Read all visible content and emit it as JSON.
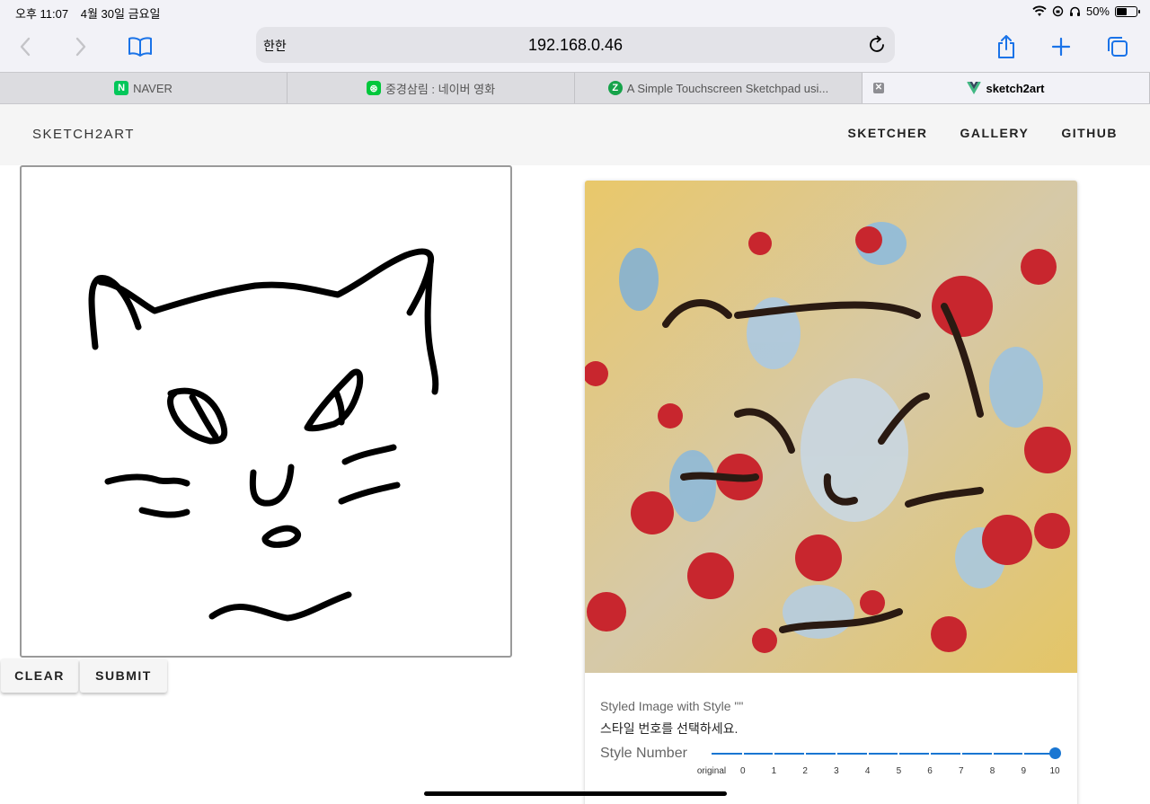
{
  "status": {
    "time": "오후 11:07",
    "date": "4월 30일 금요일",
    "battery": "50%",
    "battery_level": 0.5
  },
  "browser": {
    "address_aa": "한한",
    "url": "192.168.0.46",
    "tabs": [
      {
        "label": "NAVER",
        "favicon": "naver-icon",
        "color": "#03c75a"
      },
      {
        "label": "중경삼림 : 네이버 영화",
        "favicon": "naver-movie-icon",
        "color": "#00c73c"
      },
      {
        "label": "A Simple Touchscreen Sketchpad usi...",
        "favicon": "z-icon",
        "color": "#16a34a"
      },
      {
        "label": "sketch2art",
        "favicon": "vue-icon",
        "color": "#41b883"
      }
    ]
  },
  "app": {
    "brand": "SKETCH2ART",
    "nav": [
      "SKETCHER",
      "GALLERY",
      "GITHUB"
    ],
    "clear_label": "CLEAR",
    "submit_label": "SUBMIT",
    "caption": "Styled Image with Style \"\"",
    "instruction": "스타일 번호를 선택하세요.",
    "slider_label": "Style Number",
    "slider_ticks": [
      "original",
      "0",
      "1",
      "2",
      "3",
      "4",
      "5",
      "6",
      "7",
      "8",
      "9",
      "10"
    ],
    "slider_value": "10"
  },
  "colors": {
    "accent": "#1976d2"
  }
}
